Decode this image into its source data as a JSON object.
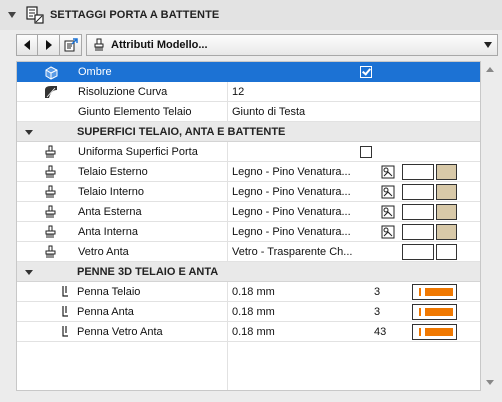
{
  "panel": {
    "title": "SETTAGGI PORTA A BATTENTE",
    "icon": "door-settings-icon"
  },
  "toolbar": {
    "prev_icon": "arrow-left-icon",
    "next_icon": "arrow-right-icon",
    "export_icon": "document-export-icon",
    "dropdown_icon": "paintbrush-icon",
    "dropdown_label": "Attributi Modello..."
  },
  "rows_top": [
    {
      "name": "Ombre",
      "icon": "cube-shadow-icon",
      "checked": true,
      "selected": true
    },
    {
      "name": "Risoluzione Curva",
      "icon": "curve-resolution-icon",
      "value": "12"
    },
    {
      "name": "Giunto Elemento Telaio",
      "value": "Giunto di Testa"
    }
  ],
  "section1": {
    "label": "SUPERFICI TELAIO, ANTA E BATTENTE"
  },
  "surface_rows": [
    {
      "name": "Uniforma Superfici Porta",
      "icon": "paint-bucket-icon",
      "checked": false
    },
    {
      "name": "Telaio Esterno",
      "icon": "paint-bucket-icon",
      "value": "Legno - Pino Venatura...",
      "mat_icon": "material-pick-icon",
      "swatch_color": "#d8c9a8"
    },
    {
      "name": "Telaio Interno",
      "icon": "paint-bucket-icon",
      "value": "Legno - Pino Venatura...",
      "mat_icon": "material-pick-icon",
      "swatch_color": "#d8c9a8"
    },
    {
      "name": "Anta Esterna",
      "icon": "paint-bucket-icon",
      "value": "Legno - Pino Venatura...",
      "mat_icon": "material-pick-icon",
      "swatch_color": "#d8c9a8"
    },
    {
      "name": "Anta Interna",
      "icon": "paint-bucket-icon",
      "value": "Legno - Pino Venatura...",
      "mat_icon": "material-pick-icon",
      "swatch_color": "#d8c9a8"
    },
    {
      "name": "Vetro Anta",
      "icon": "paint-bucket-icon",
      "value": "Vetro - Trasparente Ch...",
      "swatch_color": "#ffffff"
    }
  ],
  "section2": {
    "label": "PENNE 3D TELAIO E ANTA"
  },
  "pen_rows": [
    {
      "name": "Penna Telaio",
      "icon": "pen-icon",
      "value": "0.18 mm",
      "number": "3",
      "pen_color": "#f07800"
    },
    {
      "name": "Penna Anta",
      "icon": "pen-icon",
      "value": "0.18 mm",
      "number": "3",
      "pen_color": "#f07800"
    },
    {
      "name": "Penna Vetro Anta",
      "icon": "pen-icon",
      "value": "0.18 mm",
      "number": "43",
      "pen_color": "#f07800"
    }
  ],
  "colors": {
    "selection": "#1c72d4",
    "wood": "#d8c9a8",
    "pen": "#f07800"
  }
}
